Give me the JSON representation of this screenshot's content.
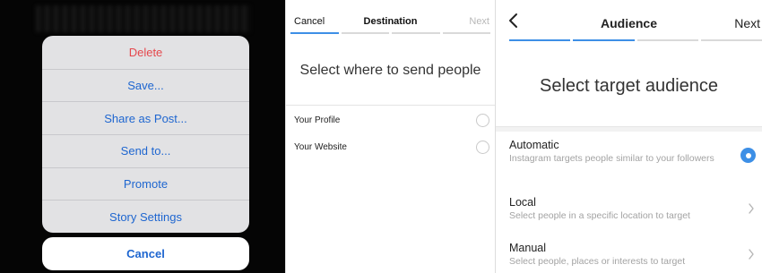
{
  "action_sheet": {
    "items": [
      {
        "label": "Delete",
        "style": "destructive"
      },
      {
        "label": "Save..."
      },
      {
        "label": "Share as Post..."
      },
      {
        "label": "Send to..."
      },
      {
        "label": "Promote"
      },
      {
        "label": "Story Settings"
      }
    ],
    "cancel_label": "Cancel"
  },
  "destination": {
    "cancel_label": "Cancel",
    "title": "Destination",
    "next_label": "Next",
    "prompt": "Select where to send people",
    "options": [
      {
        "label": "Your Profile"
      },
      {
        "label": "Your Website"
      }
    ],
    "progress": {
      "steps": 4,
      "current": 1
    }
  },
  "audience": {
    "back_icon": "chevron-left-icon",
    "title": "Audience",
    "next_label": "Next",
    "prompt": "Select target audience",
    "progress": {
      "steps": 4,
      "current": 2
    },
    "options": [
      {
        "title": "Automatic",
        "description": "Instagram targets people similar to your followers",
        "selected": true
      },
      {
        "title": "Local",
        "description": "Select people in a specific location to target"
      },
      {
        "title": "Manual",
        "description": "Select people, places or interests to target"
      }
    ]
  },
  "colors": {
    "accent": "#3d8fe6",
    "action_blue": "#1e66d0",
    "destructive": "#e5484d"
  }
}
